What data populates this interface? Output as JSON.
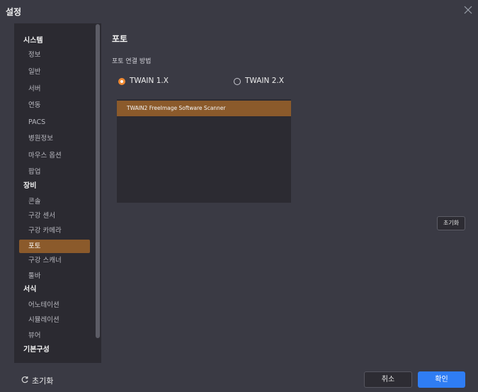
{
  "window": {
    "title": "설정"
  },
  "sidebar": {
    "items": [
      {
        "label": "시스템",
        "type": "section"
      },
      {
        "label": "정보",
        "type": "item"
      },
      {
        "label": "일반",
        "type": "item"
      },
      {
        "label": "서버",
        "type": "item"
      },
      {
        "label": "연동",
        "type": "item"
      },
      {
        "label": "PACS",
        "type": "item"
      },
      {
        "label": "병원정보",
        "type": "item"
      },
      {
        "label": "마우스 옵션",
        "type": "item"
      },
      {
        "label": "팝업",
        "type": "item"
      },
      {
        "label": "장비",
        "type": "section"
      },
      {
        "label": "콘솔",
        "type": "item"
      },
      {
        "label": "구강 센서",
        "type": "item"
      },
      {
        "label": "구강 카메라",
        "type": "item"
      },
      {
        "label": "포토",
        "type": "item",
        "active": true
      },
      {
        "label": "구강 스캐너",
        "type": "item"
      },
      {
        "label": "툴바",
        "type": "item"
      },
      {
        "label": "서식",
        "type": "section"
      },
      {
        "label": "어노테이션",
        "type": "item"
      },
      {
        "label": "시뮬레이션",
        "type": "item"
      },
      {
        "label": "뷰어",
        "type": "item"
      },
      {
        "label": "기본구성",
        "type": "section"
      }
    ]
  },
  "content": {
    "title": "포토",
    "connection_label": "포토 연결 방법",
    "radio_options": [
      {
        "label": "TWAIN 1.X",
        "selected": true
      },
      {
        "label": "TWAIN 2.X",
        "selected": false
      }
    ],
    "scanners": [
      "TWAIN2 FreeImage Software Scanner"
    ],
    "reset_button": "초기화"
  },
  "footer": {
    "reset_label": "초기화",
    "cancel_label": "취소",
    "ok_label": "확인"
  },
  "colors": {
    "accent": "#8b5a2b",
    "radio_selected": "#f08a33",
    "primary_button": "#2f7df4"
  },
  "icons": {
    "close": "close-icon",
    "reset": "refresh-icon"
  }
}
